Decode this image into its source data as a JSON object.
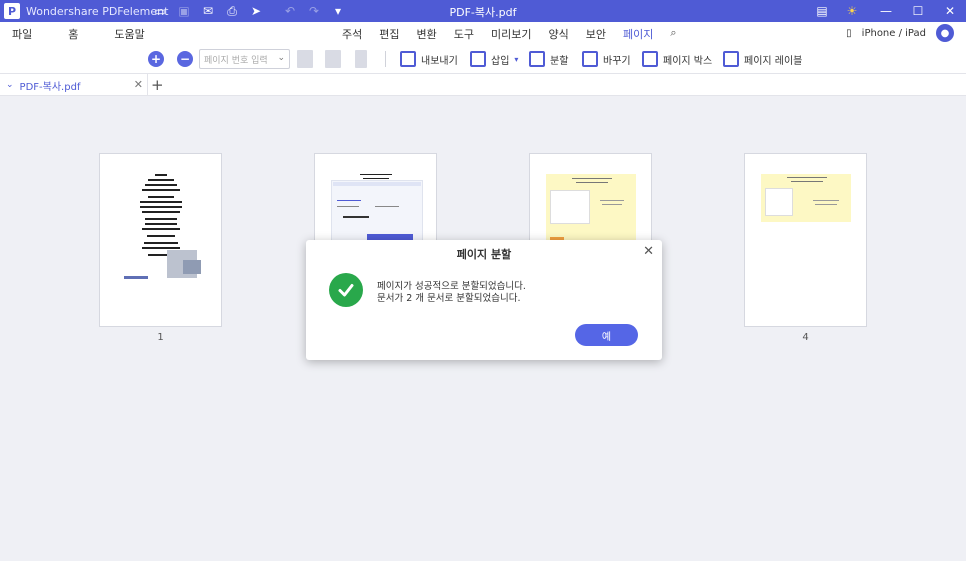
{
  "titlebar": {
    "app_name": "Wondershare PDFelement",
    "document_title": "PDF-복사.pdf"
  },
  "menu": {
    "left": [
      "파일",
      "홈",
      "도움말"
    ],
    "center": [
      "주석",
      "편집",
      "변환",
      "도구",
      "미리보기",
      "양식",
      "보안",
      "페이지"
    ],
    "active": "페이지",
    "device": "iPhone / iPad"
  },
  "toolbar": {
    "page_input_placeholder": "페이지 번호 입력",
    "export": "내보내기",
    "insert": "삽입",
    "split": "분할",
    "replace": "바꾸기",
    "page_box": "페이지 박스",
    "page_label": "페이지 레이블"
  },
  "tab": {
    "name": "PDF-복사.pdf"
  },
  "pages": [
    {
      "number": "1"
    },
    {
      "number": ""
    },
    {
      "number": ""
    },
    {
      "number": "4"
    }
  ],
  "dialog": {
    "title": "페이지 분할",
    "message_line1": "페이지가 성공적으로 분할되었습니다.",
    "message_line2": "문서가 2 개 문서로 분할되었습니다.",
    "ok_label": "예"
  },
  "colors": {
    "accent": "#4f5bd5",
    "success": "#29a84b",
    "button": "#5566e6"
  }
}
